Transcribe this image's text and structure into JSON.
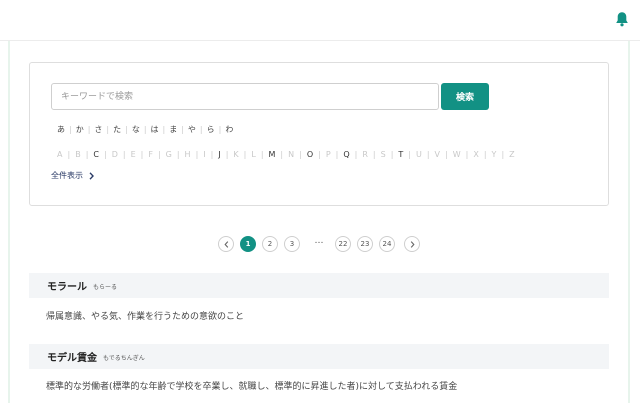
{
  "header": {
    "bell_icon": "bell-icon",
    "accent_color": "#129184"
  },
  "search": {
    "placeholder": "キーワードで検索",
    "value": "",
    "button_label": "検索"
  },
  "kana_index": [
    "あ",
    "か",
    "さ",
    "た",
    "な",
    "は",
    "ま",
    "や",
    "ら",
    "わ"
  ],
  "alpha_index": [
    {
      "letter": "A",
      "enabled": false
    },
    {
      "letter": "B",
      "enabled": false
    },
    {
      "letter": "C",
      "enabled": true
    },
    {
      "letter": "D",
      "enabled": false
    },
    {
      "letter": "E",
      "enabled": false
    },
    {
      "letter": "F",
      "enabled": false
    },
    {
      "letter": "G",
      "enabled": false
    },
    {
      "letter": "H",
      "enabled": false
    },
    {
      "letter": "I",
      "enabled": false
    },
    {
      "letter": "J",
      "enabled": true
    },
    {
      "letter": "K",
      "enabled": false
    },
    {
      "letter": "L",
      "enabled": false
    },
    {
      "letter": "M",
      "enabled": true
    },
    {
      "letter": "N",
      "enabled": false
    },
    {
      "letter": "O",
      "enabled": true
    },
    {
      "letter": "P",
      "enabled": false
    },
    {
      "letter": "Q",
      "enabled": true
    },
    {
      "letter": "R",
      "enabled": false
    },
    {
      "letter": "S",
      "enabled": false
    },
    {
      "letter": "T",
      "enabled": true
    },
    {
      "letter": "U",
      "enabled": false
    },
    {
      "letter": "V",
      "enabled": false
    },
    {
      "letter": "W",
      "enabled": false
    },
    {
      "letter": "X",
      "enabled": false
    },
    {
      "letter": "Y",
      "enabled": false
    },
    {
      "letter": "Z",
      "enabled": false
    }
  ],
  "show_all": {
    "label": "全件表示",
    "icon": "chevron-right-icon"
  },
  "pagination": {
    "prev_icon": "chevron-left-icon",
    "next_icon": "chevron-right-icon",
    "pages_before": [
      "1",
      "2",
      "3"
    ],
    "ellipsis": "…",
    "pages_after": [
      "22",
      "23",
      "24"
    ],
    "current": "1"
  },
  "terms": [
    {
      "name": "モラール",
      "reading": "もらーる",
      "definition": "帰属意識、やる気、作業を行うための意欲のこと"
    },
    {
      "name": "モデル賃金",
      "reading": "もでるちんぎん",
      "definition": "標準的な労働者(標準的な年齢で学校を卒業し、就職し、標準的に昇進した者)に対して支払われる賃金"
    }
  ]
}
